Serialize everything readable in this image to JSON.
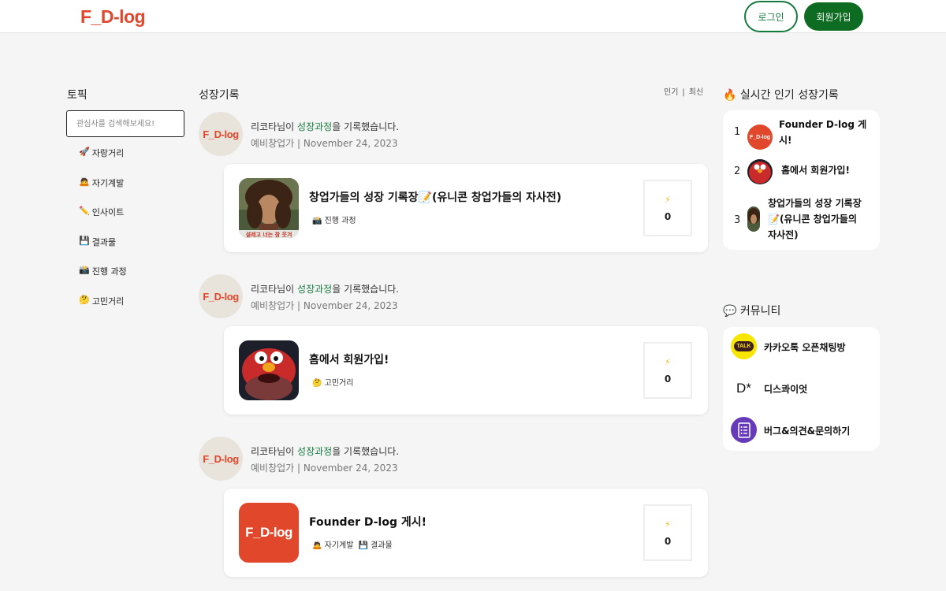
{
  "header": {
    "logo": "F_D-log",
    "login_label": "로그인",
    "signup_label": "회원가입"
  },
  "sidebar": {
    "title": "토픽",
    "search_placeholder": "관심사를 검색해보세요!",
    "topics": [
      {
        "icon": "🚀",
        "label": "자랑거리"
      },
      {
        "icon": "🙇",
        "label": "자기계발"
      },
      {
        "icon": "✏️",
        "label": "인사이트"
      },
      {
        "icon": "💾",
        "label": "결과물"
      },
      {
        "icon": "📸",
        "label": "진행 과정"
      },
      {
        "icon": "🤔",
        "label": "고민거리"
      }
    ]
  },
  "feed": {
    "title": "성장기록",
    "sort": {
      "popular": "인기",
      "separator": "|",
      "latest": "최신"
    },
    "entries": [
      {
        "avatar_text": "F_D-log",
        "author": "리코타님이",
        "action_highlight": "성장과정",
        "action_suffix": "을 기록했습니다.",
        "role": "예비창업가",
        "date_sep": "|",
        "date": "November 24, 2023",
        "card_title": "창업가들의 성장 기록장📝(유니콘 창업가들의 자사전)",
        "tags": [
          "📸 진행 과정"
        ],
        "like_icon": "⚡",
        "likes": "0",
        "thumb_caption": "설레고 너는 참 웃겨"
      },
      {
        "avatar_text": "F_D-log",
        "author": "리코타님이",
        "action_highlight": "성장과정",
        "action_suffix": "을 기록했습니다.",
        "role": "예비창업가",
        "date_sep": "|",
        "date": "November 24, 2023",
        "card_title": "홈에서 회원가입!",
        "tags": [
          "🤔 고민거리"
        ],
        "like_icon": "⚡",
        "likes": "0"
      },
      {
        "avatar_text": "F_D-log",
        "author": "리코타님이",
        "action_highlight": "성장과정",
        "action_suffix": "을 기록했습니다.",
        "role": "예비창업가",
        "date_sep": "|",
        "date": "November 24, 2023",
        "card_title": "Founder D-log 게시!",
        "tags": [
          "🙇 자기계발",
          "💾 결과물"
        ],
        "like_icon": "⚡",
        "likes": "0",
        "thumb_text": "F_D-log"
      }
    ]
  },
  "popular": {
    "icon": "🔥",
    "title": "실시간 인기 성장기록",
    "items": [
      {
        "rank": "1",
        "line1": "Founder D-log 게",
        "line2": "시!",
        "thumb_text": "F_D-log"
      },
      {
        "rank": "2",
        "line1": "홈에서 회원가입!"
      },
      {
        "rank": "3",
        "line1": "창업가들의 성장 기록장",
        "line2": "📝(유니콘 창업가들의",
        "line3": "자사전)"
      }
    ]
  },
  "community": {
    "icon": "💬",
    "title": "커뮤니티",
    "items": [
      {
        "icon_text": "TALK",
        "label": "카카오톡 오픈채팅방"
      },
      {
        "icon_text": "D*",
        "label": "디스콰이엇"
      },
      {
        "label": "버그&의견&문의하기"
      }
    ]
  },
  "colors": {
    "brand": "#e0472b",
    "accent_green": "#157a3e",
    "signup_green": "#0e6b22",
    "kakao_yellow": "#f7e600",
    "form_purple": "#673ab7"
  }
}
